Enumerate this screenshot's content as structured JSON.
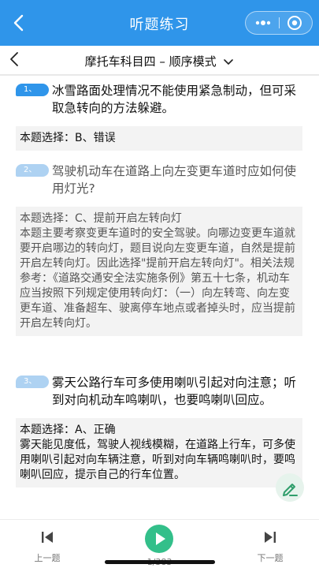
{
  "header": {
    "title": "听题练习"
  },
  "subheader": {
    "title": "摩托车科目四 – 顺序模式"
  },
  "questions": [
    {
      "number": "1、",
      "text": "冰雪路面处理情况不能使用紧急制动，但可采取急转向的方法躲避。",
      "answer": "本题选择：B、错误",
      "explanation": ""
    },
    {
      "number": "2、",
      "text": "驾驶机动车在道路上向左变更车道时应如何使用灯光?",
      "answer": "本题选择：C、提前开启左转向灯",
      "explanation": "本题主要考察变更车道时的安全驾驶。向哪边变更车道就要开启哪边的转向灯，题目说向左变更车道，自然是提前开启左转向灯。因此选择\"提前开启左转向灯\"。相关法规参考：《道路交通安全法实施条例》第五十七条，机动车应当按照下列规定使用转向灯：（一）向左转弯、向左变更车道、准备超车、驶离停车地点或者掉头时，应当提前开启左转向灯。"
    },
    {
      "number": "3、",
      "text": "雾天公路行车可多使用喇叭引起对向注意；听到对向机动车鸣喇叭，也要鸣喇叭回应。",
      "answer": "本题选择：A、正确",
      "explanation": "雾天能见度低，驾驶人视线模糊，在道路上行车，可多使用喇叭引起对向车辆注意，听到对向车辆鸣喇叭时，要鸣喇叭回应，提示自己的行车位置。"
    }
  ],
  "footer": {
    "prev_label": "上一题",
    "next_label": "下一题",
    "counter": "1/383"
  },
  "icons": {
    "back": "chevron-left-icon",
    "more": "more-dots-icon",
    "close": "target-circle-icon",
    "dropdown": "chevron-down-icon",
    "edit": "pen-icon",
    "prev": "skip-previous-icon",
    "play": "play-icon",
    "next": "skip-next-icon"
  },
  "colors": {
    "primary": "#2f95ea",
    "pill_light": "#aed2f2",
    "play_green": "#33bf8a",
    "answer_bg": "#f3f3f3"
  }
}
